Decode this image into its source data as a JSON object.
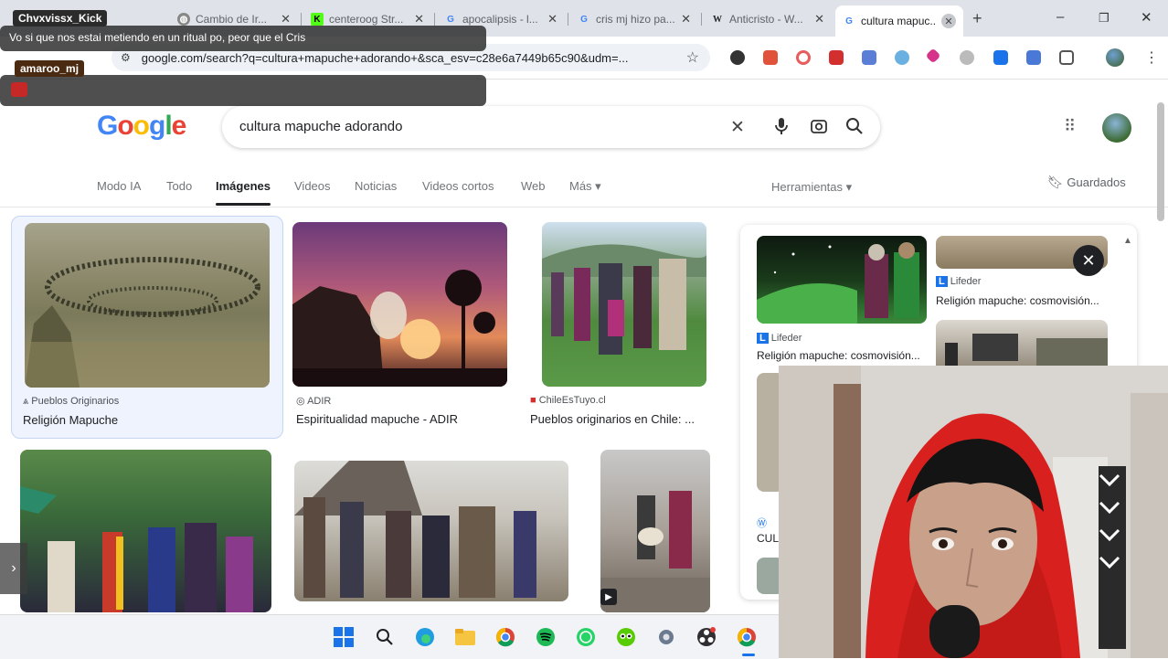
{
  "browser": {
    "tabs": [
      {
        "title": "Chvxvissx_Kick",
        "favicon": "kick-icon"
      },
      {
        "title": "Cambio de Ir...",
        "favicon": "globe-icon"
      },
      {
        "title": "centeroog Str...",
        "favicon": "kick-icon"
      },
      {
        "title": "apocalipsis - l...",
        "favicon": "google-icon"
      },
      {
        "title": "cris mj hizo pa...",
        "favicon": "google-icon"
      },
      {
        "title": "Anticristo - W...",
        "favicon": "wikipedia-icon"
      },
      {
        "title": "cultura mapuc...",
        "favicon": "google-icon",
        "active": true
      }
    ],
    "new_tab": "+",
    "window_controls": {
      "minimize": "–",
      "restore": "❐",
      "close": "✕"
    },
    "address": "google.com/search?q=cultura+mapuche+adorando+&sca_esv=c28e6a7449b65c90&udm=..."
  },
  "overlay": {
    "chat_user_1": "Chvxvissx_Kick",
    "chat_message_1": "Vo si que nos estai metiendo en un ritual po, peor que el Cris",
    "chat_user_2": "amaroo_mj"
  },
  "google": {
    "logo": "Google",
    "query": "cultura mapuche adorando",
    "tabs": [
      "Modo IA",
      "Todo",
      "Imágenes",
      "Videos",
      "Noticias",
      "Videos cortos",
      "Web",
      "Más ▾"
    ],
    "selected_tab": "Imágenes",
    "tools": "Herramientas ▾",
    "saved": "Guardados"
  },
  "results": [
    {
      "source": "Pueblos Originarios",
      "title": "Religión Mapuche"
    },
    {
      "source": "ADIR",
      "title": "Espiritualidad mapuche - ADIR"
    },
    {
      "source": "ChileEsTuyo.cl",
      "title": "Pueblos originarios en Chile: ..."
    }
  ],
  "panel": {
    "items": [
      {
        "source": "Lifeder",
        "title": "Religión mapuche: cosmovisión..."
      },
      {
        "source": "Lifeder",
        "title": "Religión mapuche: cosmovisión..."
      }
    ],
    "partial_text": "CUL"
  },
  "colors": {
    "google_blue": "#4285F4",
    "google_red": "#EA4335",
    "google_yellow": "#FBBC05",
    "google_green": "#34A853",
    "hoodie_red": "#d8201e"
  }
}
